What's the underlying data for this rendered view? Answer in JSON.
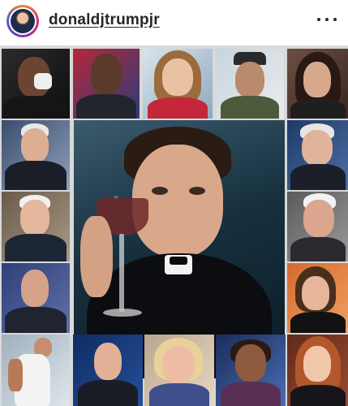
{
  "post": {
    "username": "donaldjtrumpjr",
    "more_icon": "more-horizontal-icon"
  },
  "colors": {
    "avatar_ring": [
      "#f58529",
      "#dd2a7b",
      "#8134af",
      "#515bd4"
    ],
    "text": "#262626"
  }
}
